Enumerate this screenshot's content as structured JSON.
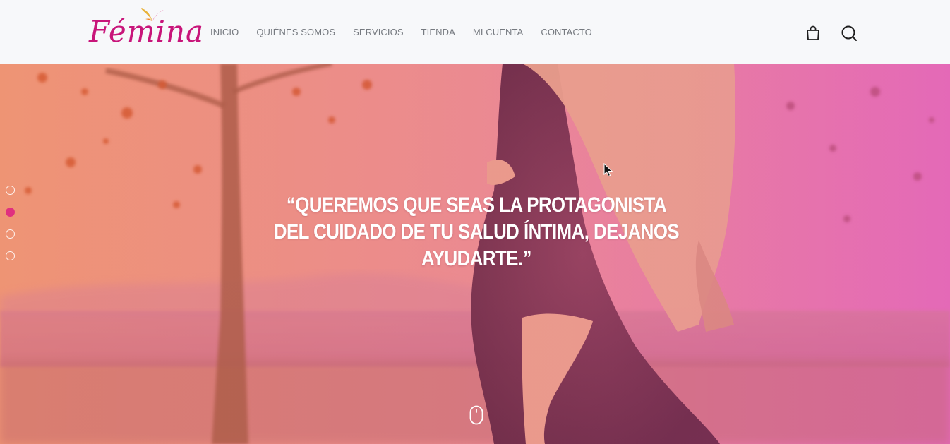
{
  "brand": {
    "logo_text": "Fémina",
    "brand_color": "#c8157a"
  },
  "nav": {
    "items": [
      {
        "label": "INICIO"
      },
      {
        "label": "QUIÉNES SOMOS"
      },
      {
        "label": "SERVICIOS"
      },
      {
        "label": "TIENDA"
      },
      {
        "label": "MI CUENTA"
      },
      {
        "label": "CONTACTO"
      }
    ]
  },
  "header_icons": {
    "cart": "shopping-bag-icon",
    "search": "search-icon"
  },
  "hero": {
    "quote": "“QUEREMOS QUE SEAS LA PROTAGONISTA DEL CUIDADO DE TU SALUD ÍNTIMA, DEJANOS AYUDARTE.”",
    "slide_count": 4,
    "active_slide": 2,
    "scroll_icon": "mouse-scroll-icon",
    "accent_color": "#e0307f"
  }
}
